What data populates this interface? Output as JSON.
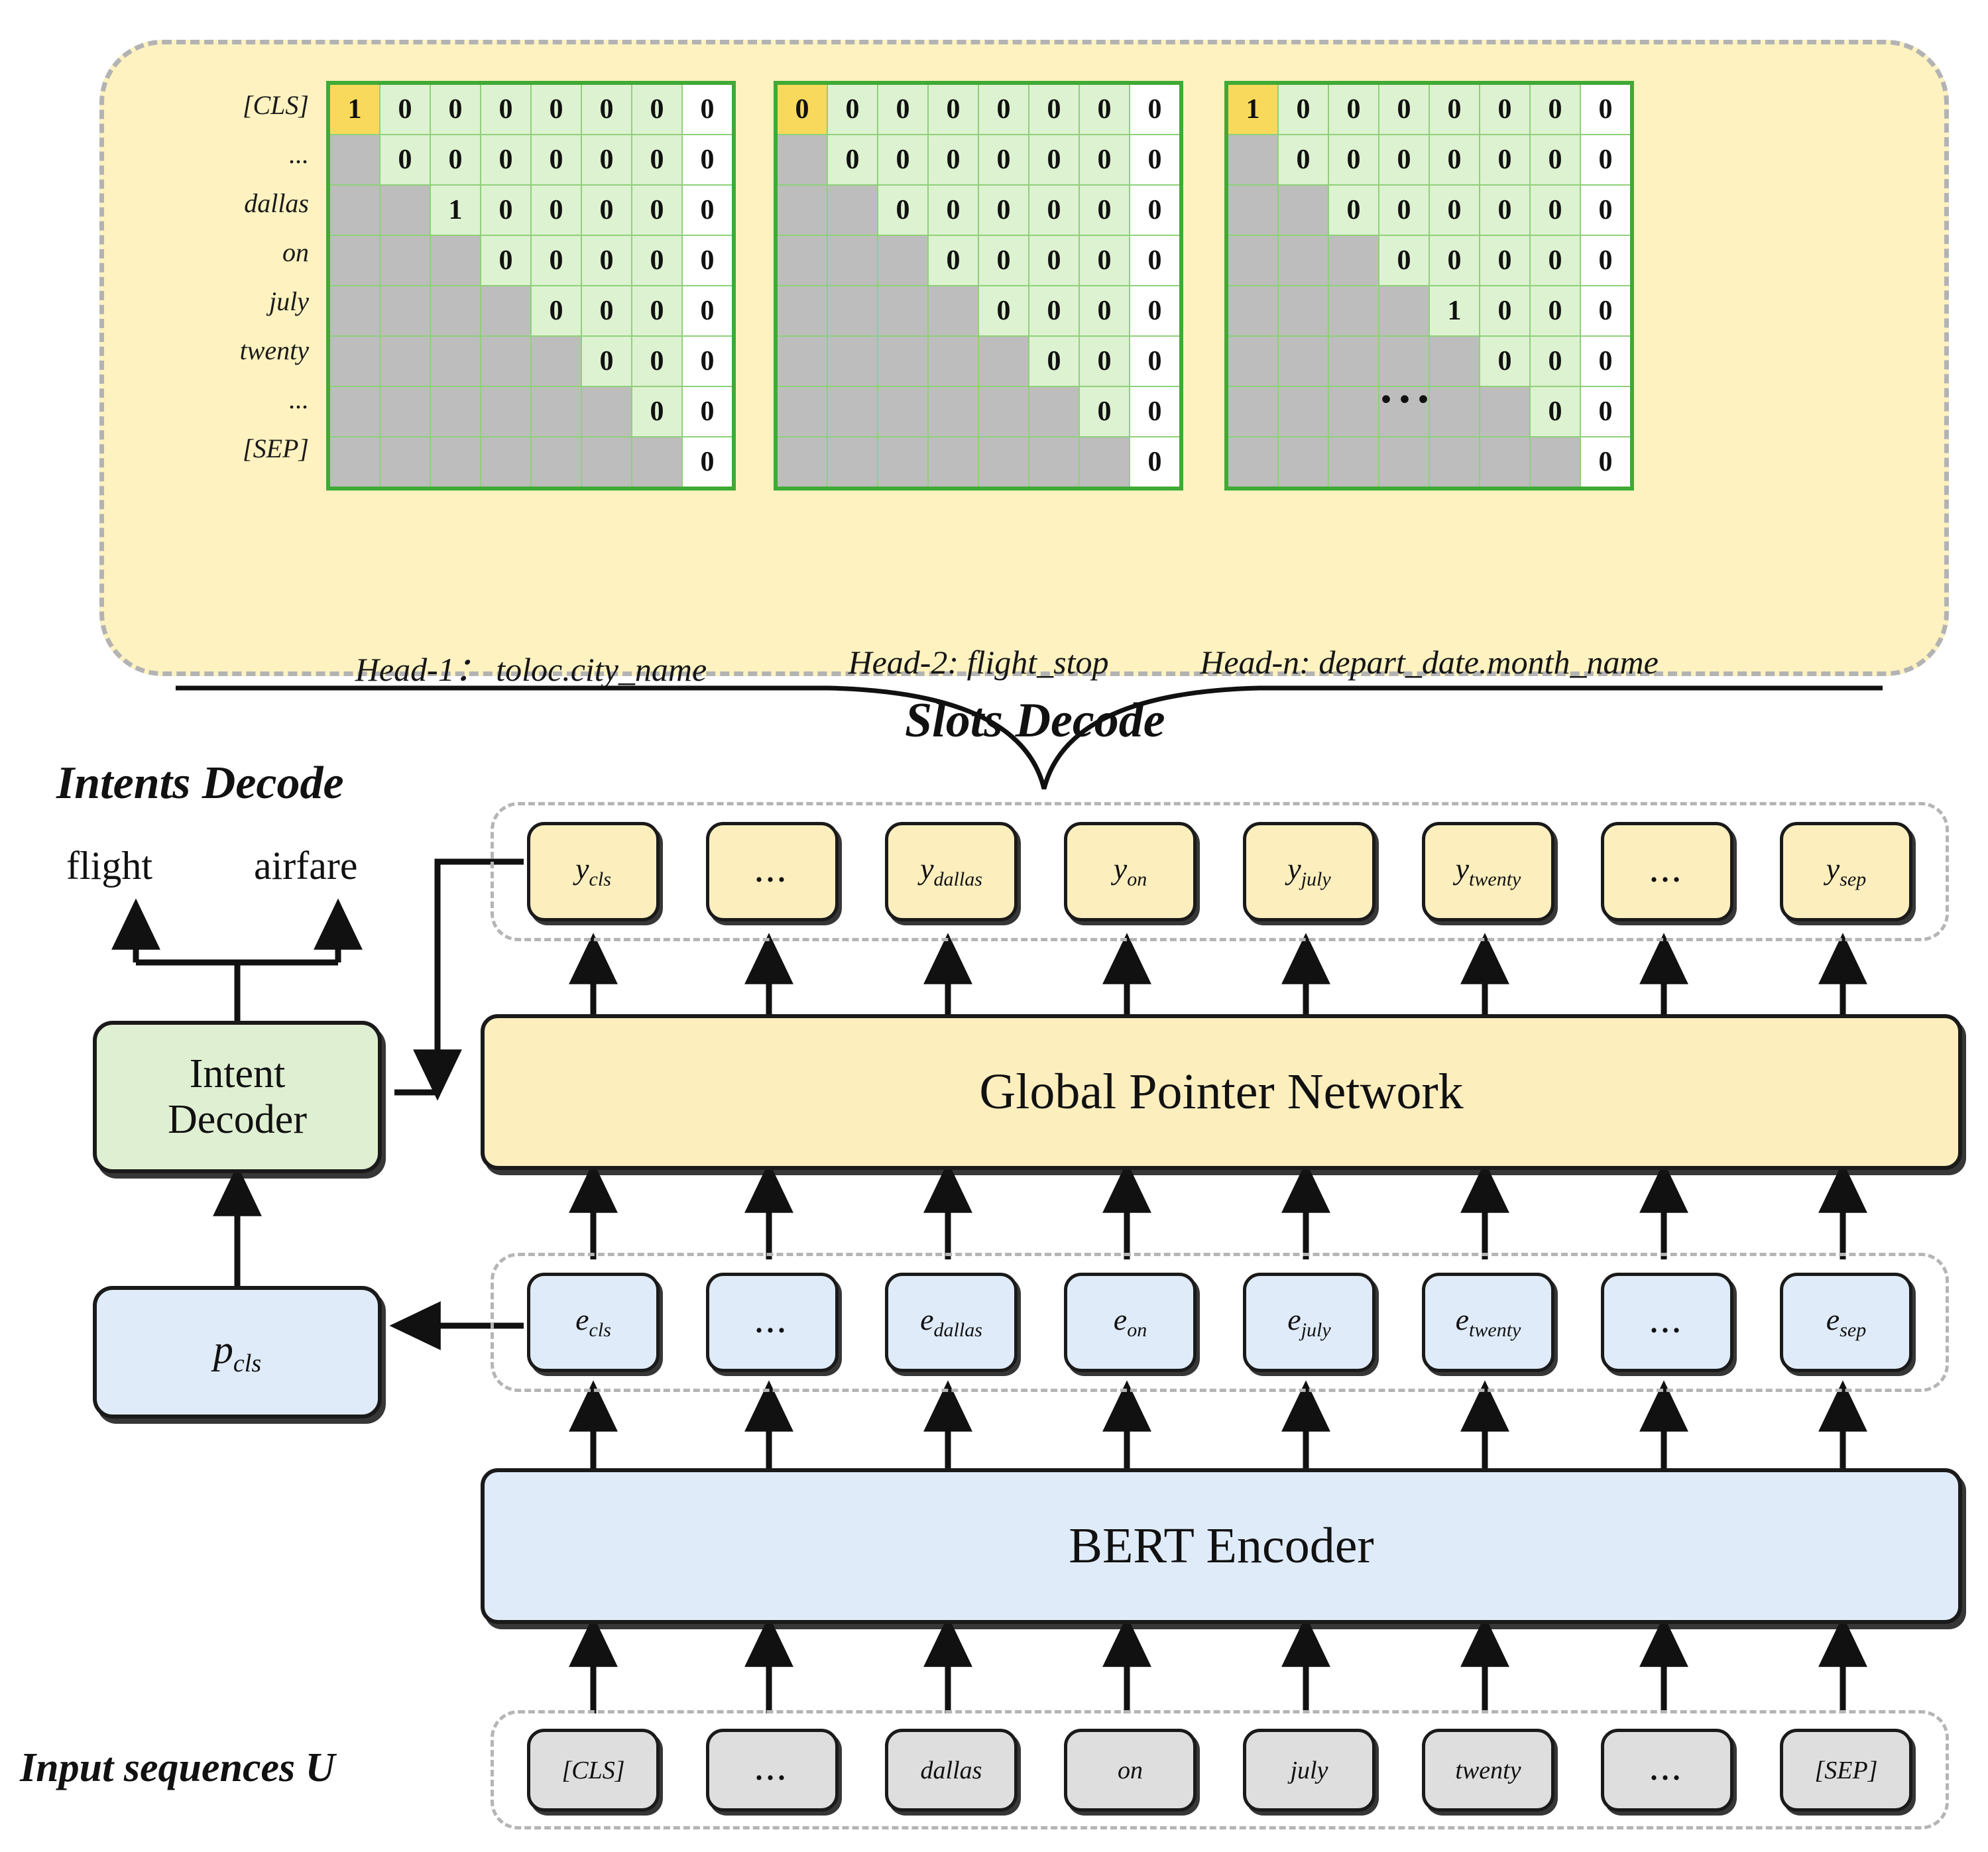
{
  "diagram": {
    "slots_decode_label": "Slots Decode",
    "intents_decode_label": "Intents Decode",
    "input_sequences_label": "Input sequences U",
    "global_pointer_network_label": "Global Pointer Network",
    "bert_encoder_label": "BERT Encoder",
    "intent_decoder_line1": "Intent",
    "intent_decoder_line2": "Decoder",
    "p_cls_label": "p",
    "p_cls_sub": "cls",
    "intent_outputs": [
      "flight",
      "airfare"
    ],
    "matrix_group_ellipsis": "..."
  },
  "colors": {
    "panel_fill": "#fdf2c0",
    "panel_border": "#b3b3b3",
    "matrix_border": "#3faa35",
    "cell_grid": "#8fd07a",
    "cell_green": "#ddf2d0",
    "cell_white": "#ffffff",
    "cell_gray": "#bdbdbd",
    "cell_yellow": "#f9d95c",
    "one_red": "#e8161a",
    "y_box": "#fdeebe",
    "e_box": "#dfebf8",
    "u_box": "#dedede",
    "intent_decoder": "#dff0d2"
  },
  "matrix_rows": [
    "[CLS]",
    "...",
    "dallas",
    "on",
    "july",
    "twenty",
    "...",
    "[SEP]"
  ],
  "heads": [
    {
      "caption": "Head-1： toloc.city_name",
      "corner_value": "1",
      "corner_is_one": true,
      "values": [
        [
          "1",
          "0",
          "0",
          "0",
          "0",
          "0",
          "0",
          "0"
        ],
        [
          "",
          "0",
          "0",
          "0",
          "0",
          "0",
          "0",
          "0"
        ],
        [
          "",
          "",
          "1",
          "0",
          "0",
          "0",
          "0",
          "0"
        ],
        [
          "",
          "",
          "",
          "0",
          "0",
          "0",
          "0",
          "0"
        ],
        [
          "",
          "",
          "",
          "",
          "0",
          "0",
          "0",
          "0"
        ],
        [
          "",
          "",
          "",
          "",
          "",
          "0",
          "0",
          "0"
        ],
        [
          "",
          "",
          "",
          "",
          "",
          "",
          "0",
          "0"
        ],
        [
          "",
          "",
          "",
          "",
          "",
          "",
          "",
          "0"
        ]
      ],
      "ones": [
        [
          0,
          0
        ],
        [
          2,
          2
        ]
      ]
    },
    {
      "caption": "Head-2: flight_stop",
      "corner_value": "0",
      "corner_is_one": false,
      "values": [
        [
          "0",
          "0",
          "0",
          "0",
          "0",
          "0",
          "0",
          "0"
        ],
        [
          "",
          "0",
          "0",
          "0",
          "0",
          "0",
          "0",
          "0"
        ],
        [
          "",
          "",
          "0",
          "0",
          "0",
          "0",
          "0",
          "0"
        ],
        [
          "",
          "",
          "",
          "0",
          "0",
          "0",
          "0",
          "0"
        ],
        [
          "",
          "",
          "",
          "",
          "0",
          "0",
          "0",
          "0"
        ],
        [
          "",
          "",
          "",
          "",
          "",
          "0",
          "0",
          "0"
        ],
        [
          "",
          "",
          "",
          "",
          "",
          "",
          "0",
          "0"
        ],
        [
          "",
          "",
          "",
          "",
          "",
          "",
          "",
          "0"
        ]
      ],
      "ones": []
    },
    {
      "caption": "Head-n: depart_date.month_name",
      "corner_value": "1",
      "corner_is_one": true,
      "values": [
        [
          "1",
          "0",
          "0",
          "0",
          "0",
          "0",
          "0",
          "0"
        ],
        [
          "",
          "0",
          "0",
          "0",
          "0",
          "0",
          "0",
          "0"
        ],
        [
          "",
          "",
          "0",
          "0",
          "0",
          "0",
          "0",
          "0"
        ],
        [
          "",
          "",
          "",
          "0",
          "0",
          "0",
          "0",
          "0"
        ],
        [
          "",
          "",
          "",
          "",
          "1",
          "0",
          "0",
          "0"
        ],
        [
          "",
          "",
          "",
          "",
          "",
          "0",
          "0",
          "0"
        ],
        [
          "",
          "",
          "",
          "",
          "",
          "",
          "0",
          "0"
        ],
        [
          "",
          "",
          "",
          "",
          "",
          "",
          "",
          "0"
        ]
      ],
      "ones": [
        [
          0,
          0
        ],
        [
          4,
          4
        ]
      ]
    }
  ],
  "y_tokens": [
    {
      "base": "y",
      "sub": "cls",
      "dots": false
    },
    {
      "base": "",
      "sub": "",
      "dots": true
    },
    {
      "base": "y",
      "sub": "dallas",
      "dots": false
    },
    {
      "base": "y",
      "sub": "on",
      "dots": false
    },
    {
      "base": "y",
      "sub": "july",
      "dots": false
    },
    {
      "base": "y",
      "sub": "twenty",
      "dots": false
    },
    {
      "base": "",
      "sub": "",
      "dots": true
    },
    {
      "base": "y",
      "sub": "sep",
      "dots": false
    }
  ],
  "e_tokens": [
    {
      "base": "e",
      "sub": "cls",
      "dots": false
    },
    {
      "base": "",
      "sub": "",
      "dots": true
    },
    {
      "base": "e",
      "sub": "dallas",
      "dots": false
    },
    {
      "base": "e",
      "sub": "on",
      "dots": false
    },
    {
      "base": "e",
      "sub": "july",
      "dots": false
    },
    {
      "base": "e",
      "sub": "twenty",
      "dots": false
    },
    {
      "base": "",
      "sub": "",
      "dots": true
    },
    {
      "base": "e",
      "sub": "sep",
      "dots": false
    }
  ],
  "u_tokens": [
    {
      "label": "[CLS]",
      "dots": false
    },
    {
      "label": "...",
      "dots": true
    },
    {
      "label": "dallas",
      "dots": false
    },
    {
      "label": "on",
      "dots": false
    },
    {
      "label": "july",
      "dots": false
    },
    {
      "label": "twenty",
      "dots": false
    },
    {
      "label": "...",
      "dots": true
    },
    {
      "label": "[SEP]",
      "dots": false
    }
  ]
}
